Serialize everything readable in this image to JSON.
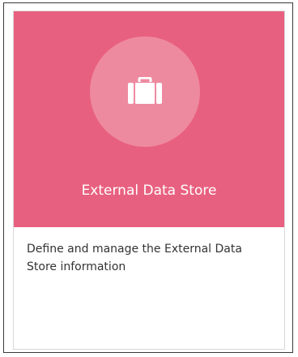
{
  "tile": {
    "title": "External Data Store",
    "description": "Define and manage the External Data Store information",
    "icon": "briefcase-icon",
    "header_color": "#e8607f",
    "circle_color": "#ee8aa0"
  }
}
